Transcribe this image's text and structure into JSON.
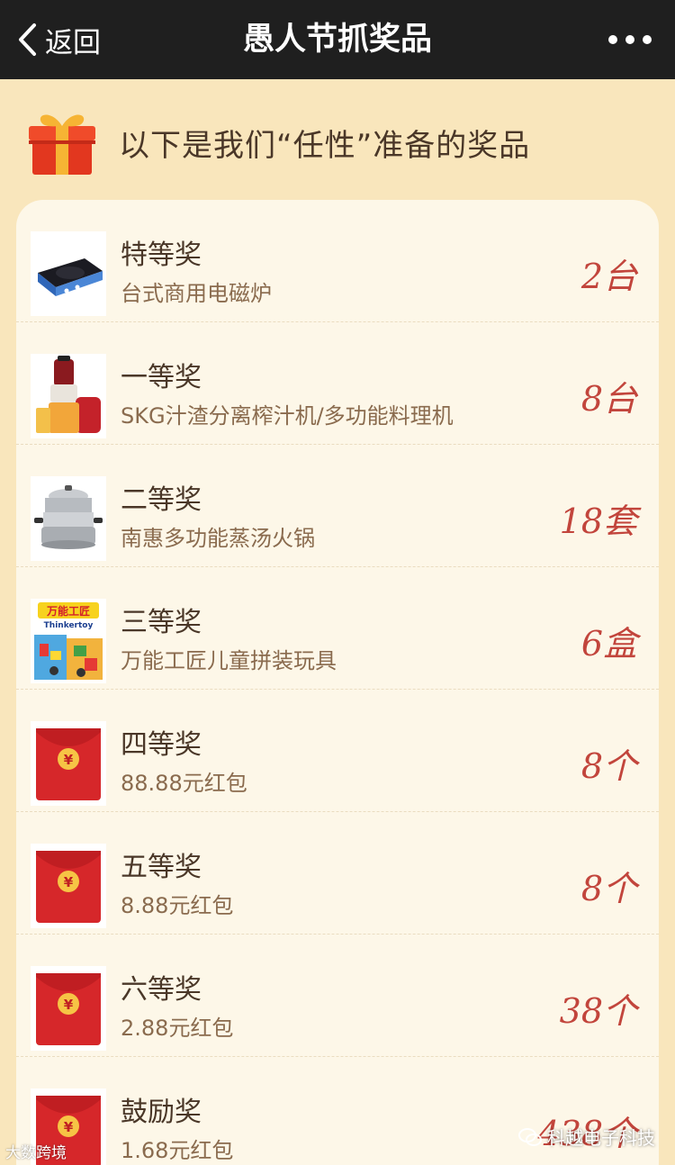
{
  "nav": {
    "back_label": "返回",
    "title": "愚人节抓奖品"
  },
  "heading": {
    "text": "以下是我们“任性”准备的奖品"
  },
  "prizes": [
    {
      "level": "特等奖",
      "desc": "台式商用电磁炉",
      "qty": "2台",
      "thumb": "induction-cooker"
    },
    {
      "level": "一等奖",
      "desc": "SKG汁渣分离榨汁机/多功能料理机",
      "qty": "8台",
      "thumb": "juicer"
    },
    {
      "level": "二等奖",
      "desc": "南惠多功能蒸汤火锅",
      "qty": "18套",
      "thumb": "steamer-pot"
    },
    {
      "level": "三等奖",
      "desc": "万能工匠儿童拼装玩具",
      "qty": "6盒",
      "thumb": "toy-box"
    },
    {
      "level": "四等奖",
      "desc": "88.88元红包",
      "qty": "8个",
      "thumb": "red-envelope"
    },
    {
      "level": "五等奖",
      "desc": "8.88元红包",
      "qty": "8个",
      "thumb": "red-envelope"
    },
    {
      "level": "六等奖",
      "desc": "2.88元红包",
      "qty": "38个",
      "thumb": "red-envelope"
    },
    {
      "level": "鼓励奖",
      "desc": "1.68元红包",
      "qty": "438个",
      "thumb": "red-envelope"
    }
  ],
  "toy_brand": {
    "name": "万能工匠",
    "en": "Thinkertoy"
  },
  "envelope_symbol": "¥",
  "watermark": {
    "left": "大数跨境",
    "right": "科越电子科技"
  },
  "colors": {
    "page_bg": "#f9e6bc",
    "nav_bg": "#1f1f1f",
    "card_bg": "#fdf7e8",
    "qty": "#c2453c",
    "envelope": "#d6272a"
  }
}
